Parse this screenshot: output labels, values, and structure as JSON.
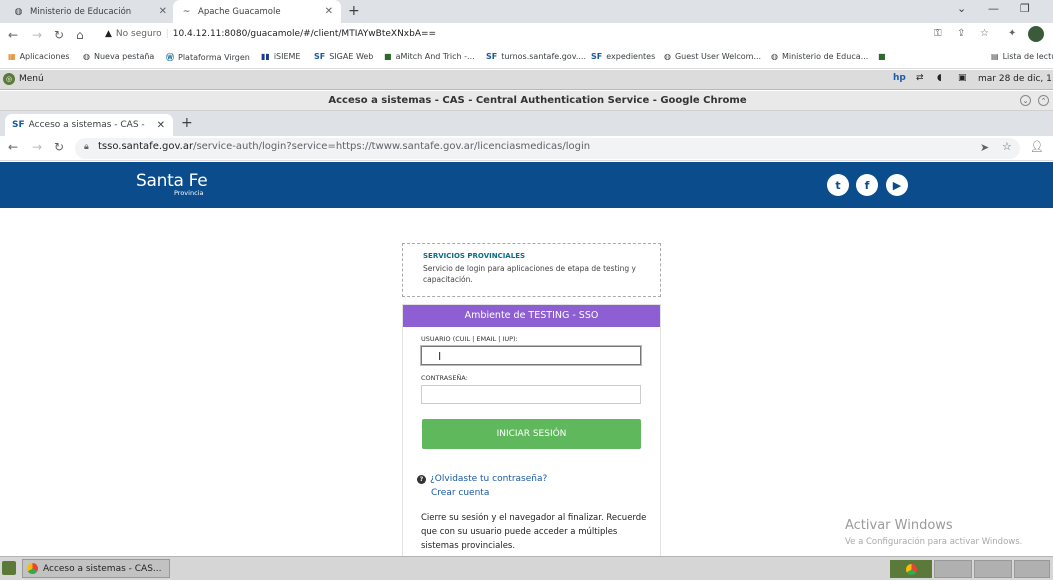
{
  "outer_browser": {
    "tabs": [
      {
        "title": "Ministerio de Educación",
        "icon": "globe-icon"
      },
      {
        "title": "Apache Guacamole",
        "icon": "guacamole-icon"
      }
    ],
    "address": {
      "security_label": "No seguro",
      "url": "10.4.12.11:8080/guacamole/#/client/MTIAYwBteXNxbA=="
    },
    "bookmarks": [
      {
        "label": "Aplicaciones",
        "icon": "apps-grid-icon"
      },
      {
        "label": "Nueva pestaña",
        "icon": "globe-icon"
      },
      {
        "label": "Plataforma Virgen",
        "icon": "wordpress-icon"
      },
      {
        "label": "iSIEME",
        "icon": "bar-icon"
      },
      {
        "label": "SIGAE Web",
        "icon": "sf-icon"
      },
      {
        "label": "aMitch And Trich -...",
        "icon": "green-square-icon"
      },
      {
        "label": "turnos.santafe.gov....",
        "icon": "sf-icon"
      },
      {
        "label": "expedientes",
        "icon": "sf-icon"
      },
      {
        "label": "Guest User Welcom...",
        "icon": "globe-icon"
      },
      {
        "label": "Ministerio de Educa...",
        "icon": "globe-icon"
      },
      {
        "label": "",
        "icon": "green-square-icon"
      },
      {
        "label": "Lista de lectu",
        "icon": "reading-list-icon"
      }
    ]
  },
  "desktop": {
    "menu_label": "Menú",
    "datetime": "mar 28 de dic, 1:"
  },
  "inner_browser": {
    "window_title": "Acceso a sistemas - CAS - Central Authentication Service - Google Chrome",
    "tab_title": "Acceso a sistemas - CAS -",
    "tab_icon_text": "SF",
    "url_host": "tsso.santafe.gov.ar",
    "url_path": "/service-auth/login?service=https://twww.santafe.gov.ar/licenciasmedicas/login"
  },
  "page": {
    "logo_text": "Santa Fe",
    "logo_sub": "Provincia",
    "social": [
      "twitter-icon",
      "facebook-icon",
      "youtube-icon"
    ],
    "service_heading": "SERVICIOS PROVINCIALES",
    "service_desc": "Servicio de login para aplicaciones de etapa de testing y capacitación.",
    "card_title": "Ambiente de TESTING - SSO",
    "user_label": "USUARIO (CUIL | EMAIL | IUP):",
    "user_value": "",
    "password_label": "CONTRASEÑA:",
    "password_value": "",
    "login_button": "INICIAR SESIÓN",
    "forgot_link": "¿Olvidaste tu contraseña?",
    "create_link": "Crear cuenta",
    "notice": "Cierre su sesión y el navegador al finalizar. Recuerde que con su usuario puede acceder a múltiples sistemas provinciales.",
    "watermark_title": "Activar Windows",
    "watermark_sub": "Ve a Configuración para activar Windows."
  },
  "taskbar": {
    "task_label": "Acceso a sistemas - CAS..."
  },
  "colors": {
    "header_blue": "#0b4d8c",
    "card_purple": "#8d5fd3",
    "button_green": "#5fb85c",
    "link_blue": "#1a5aa7"
  }
}
